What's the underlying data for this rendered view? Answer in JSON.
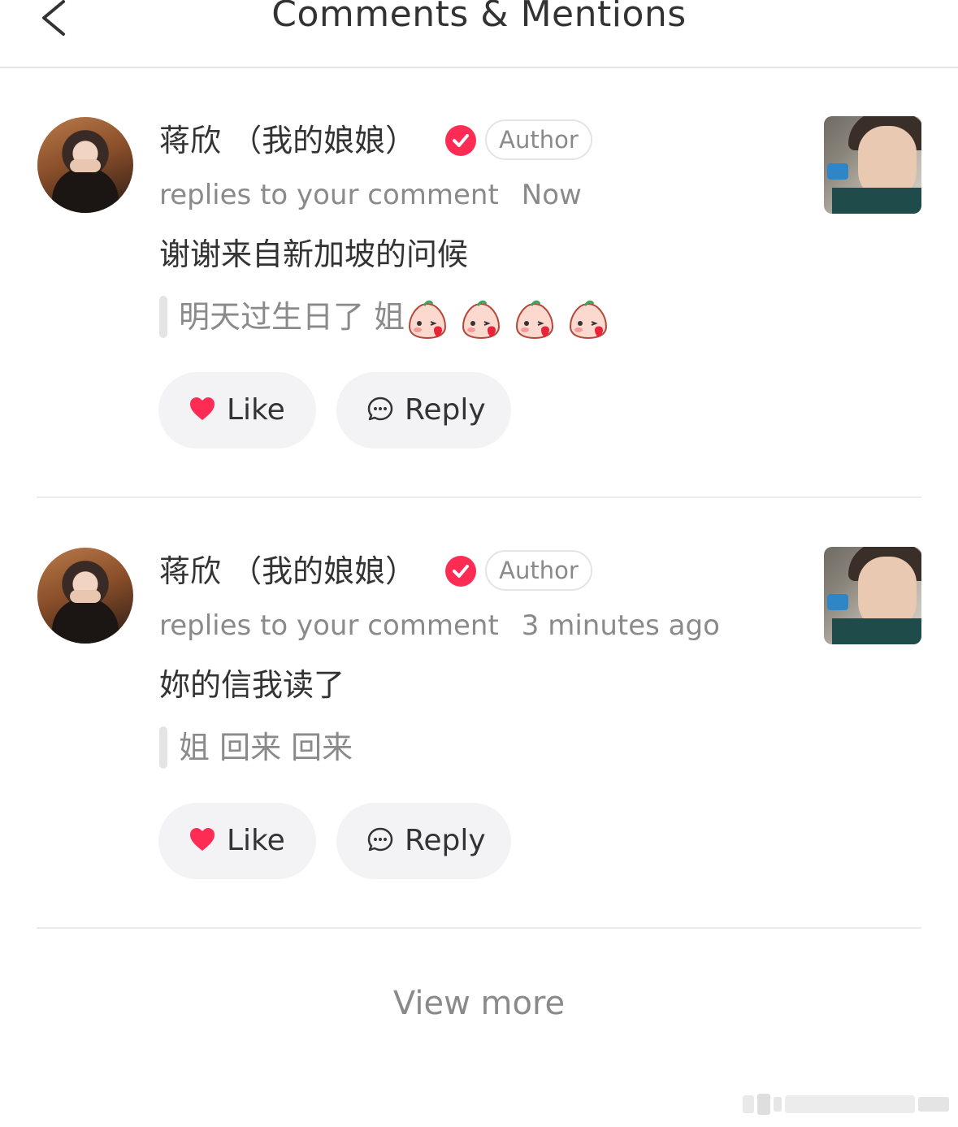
{
  "header": {
    "title": "Comments & Mentions",
    "back_icon": "chevron-left-icon"
  },
  "colors": {
    "accent": "#fe2c55",
    "text": "#333333",
    "muted": "#8a8a8a",
    "button_bg": "#f3f3f5"
  },
  "notifications": [
    {
      "username": "蒋欣 （我的娘娘）",
      "badge": "Author",
      "action": "replies to your comment",
      "time": "Now",
      "reply": "谢谢来自新加坡的问候",
      "quoted": "明天过生日了 姐",
      "quoted_emojis": [
        "blush-kiss-emoji",
        "blush-kiss-emoji",
        "blush-kiss-emoji",
        "blush-kiss-emoji"
      ],
      "like_label": "Like",
      "reply_label": "Reply"
    },
    {
      "username": "蒋欣 （我的娘娘）",
      "badge": "Author",
      "action": "replies to your comment",
      "time": "3 minutes ago",
      "reply": "妳的信我读了",
      "quoted": "姐 回来 回来",
      "like_label": "Like",
      "reply_label": "Reply"
    }
  ],
  "footer": {
    "view_more": "View more"
  }
}
